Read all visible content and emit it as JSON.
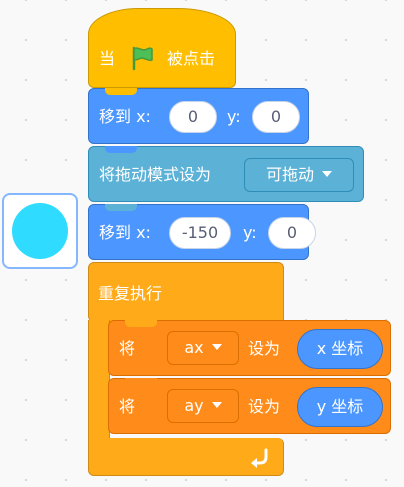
{
  "blocks": {
    "hat": {
      "when": "当",
      "flag_icon": "green-flag-icon",
      "clicked": "被点击"
    },
    "goto1": {
      "label": "移到 x:",
      "x": "0",
      "ylabel": "y:",
      "y": "0"
    },
    "drag": {
      "label": "将拖动模式设为",
      "value": "可拖动"
    },
    "goto2": {
      "label": "移到 x:",
      "x": "-150",
      "ylabel": "y:",
      "y": "0"
    },
    "forever": {
      "label": "重复执行",
      "loop_icon": "loop-arrow-icon"
    },
    "set1": {
      "label": "将",
      "variable": "ax",
      "to": "设为",
      "reporter": "x 坐标"
    },
    "set2": {
      "label": "将",
      "variable": "ay",
      "to": "设为",
      "reporter": "y 坐标"
    }
  },
  "sprite": {
    "name": "sprite-thumbnail",
    "color": "#2fdcff"
  },
  "colors": {
    "events": "#ffbf00",
    "motion": "#4c97ff",
    "sensing": "#5cb1d6",
    "control": "#ffab19",
    "variables": "#ff8c1a"
  }
}
